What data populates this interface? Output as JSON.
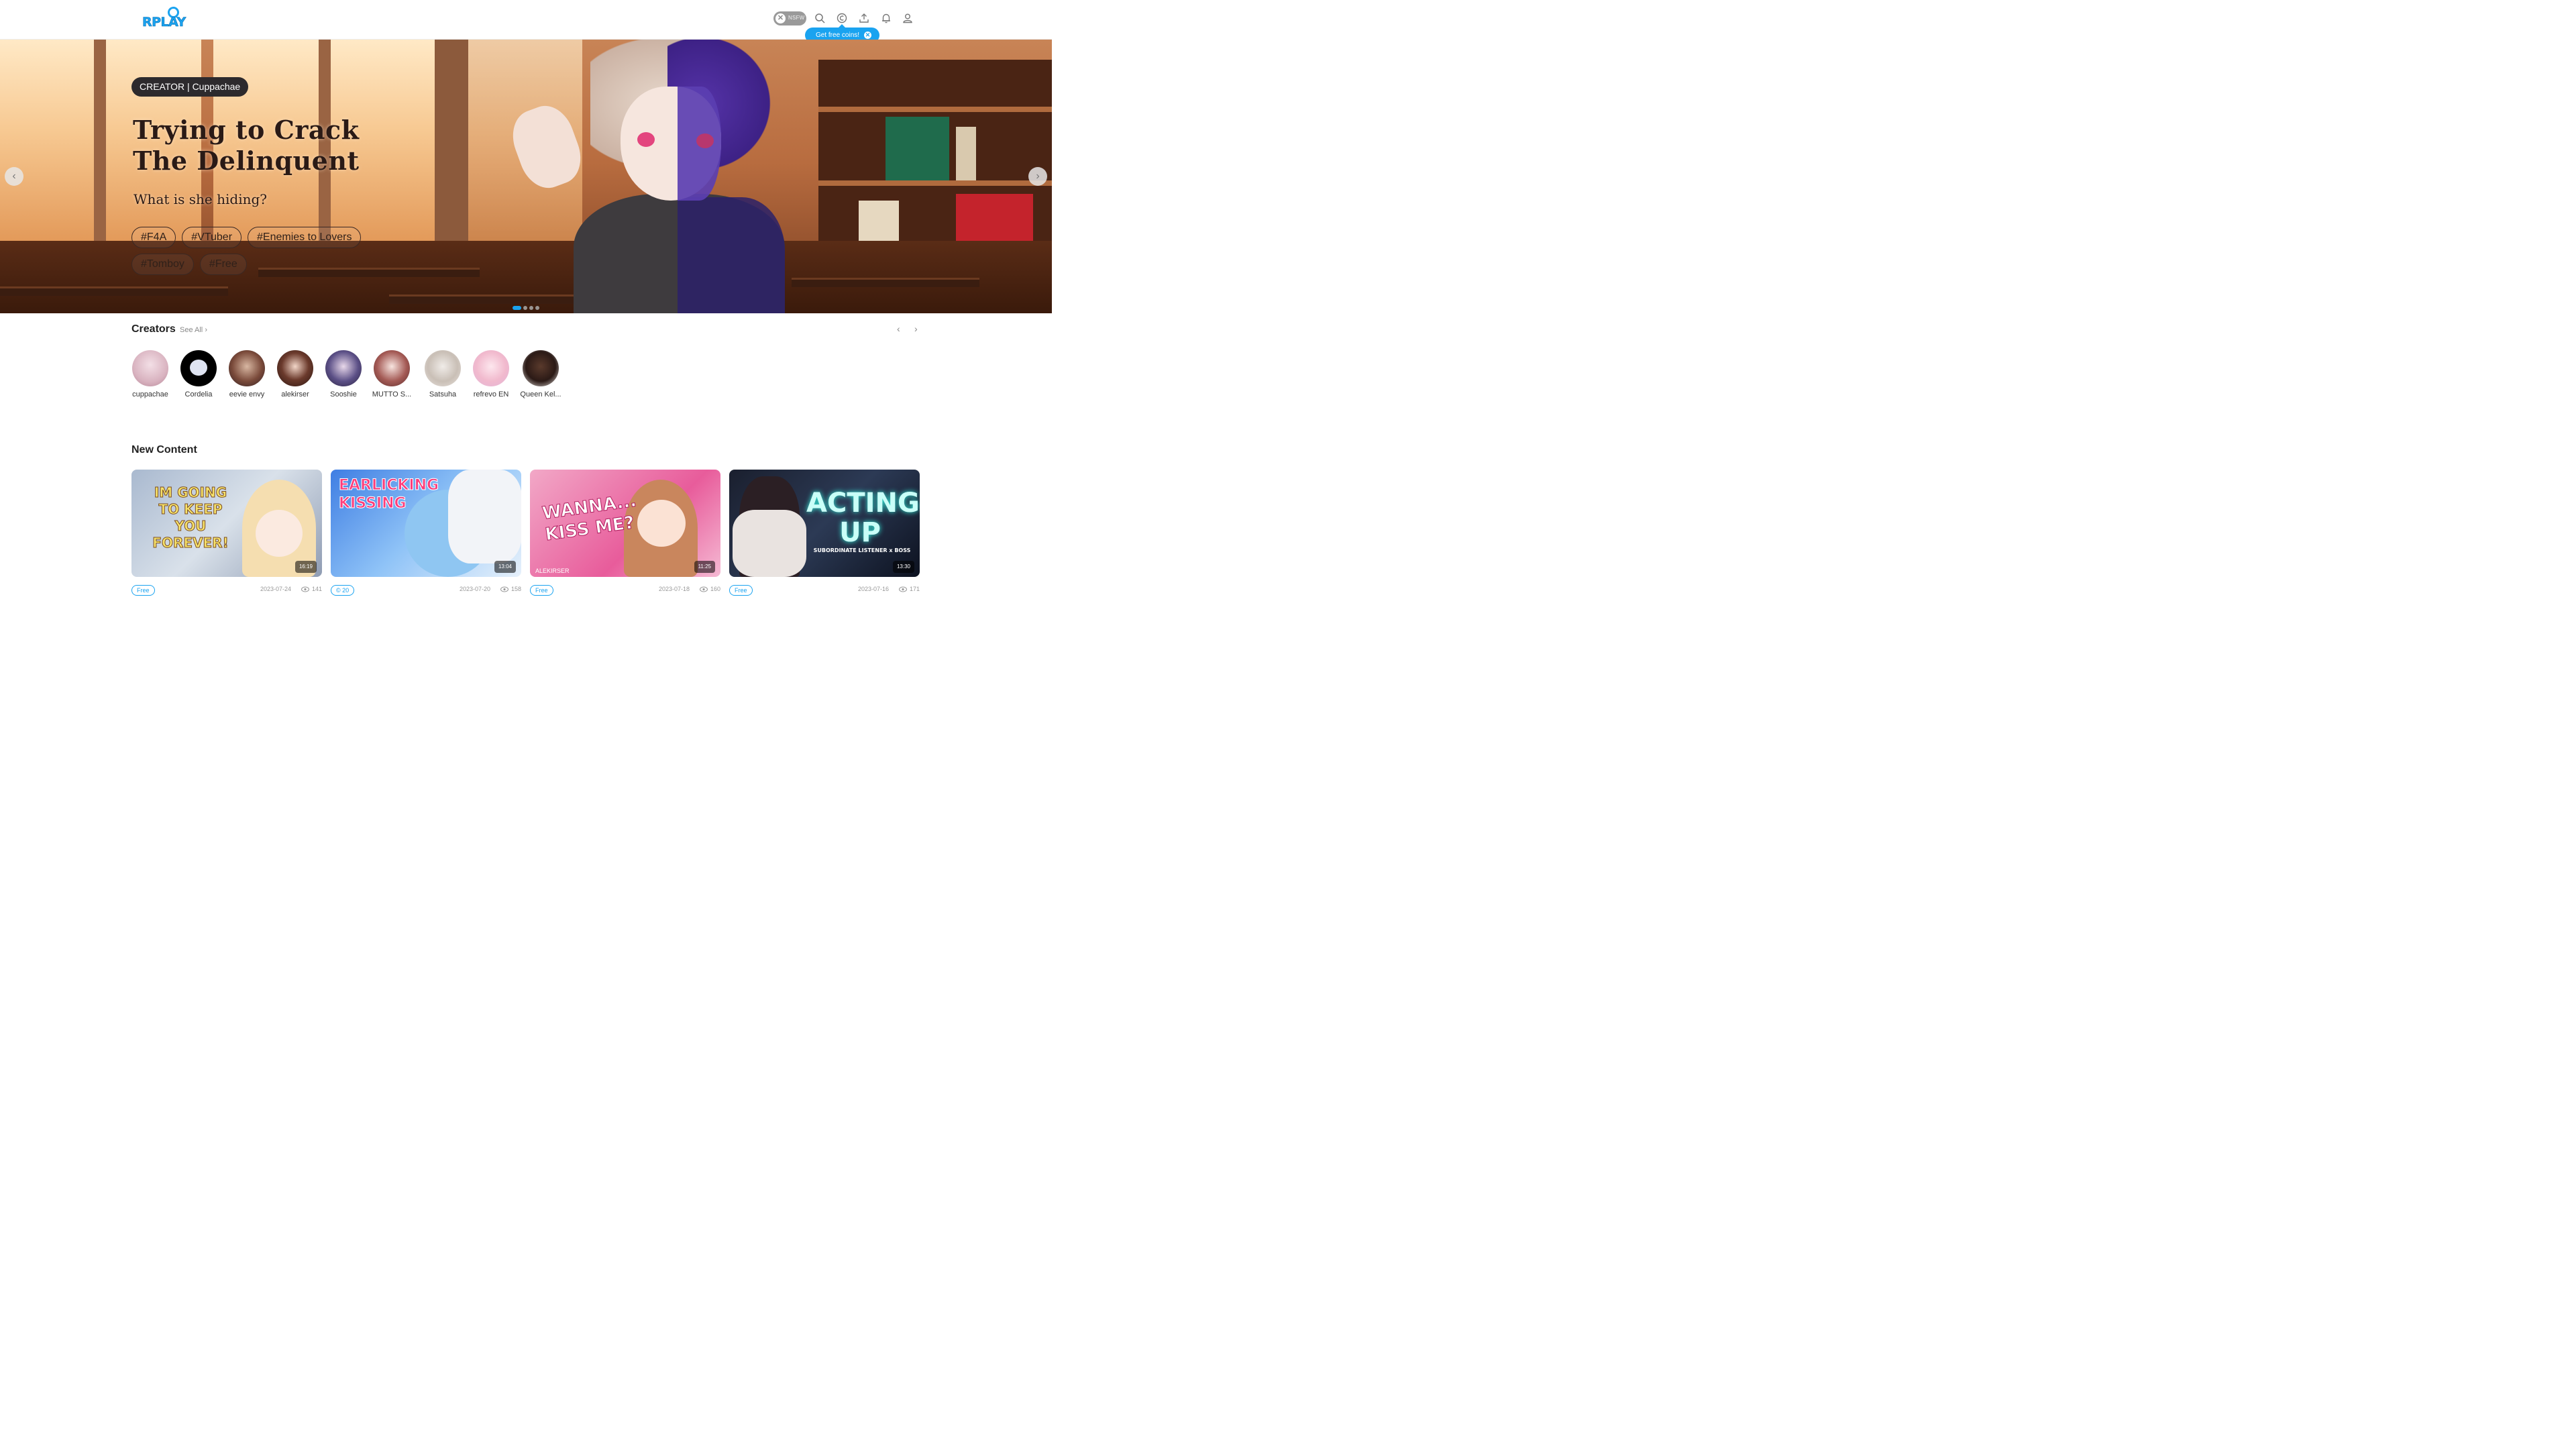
{
  "header": {
    "logo": "RPLAY",
    "nsfw_label": "NSFW",
    "tooltip_label": "Get free coins!",
    "icons": [
      "search-icon",
      "coin-icon",
      "upload-icon",
      "bell-icon",
      "user-icon"
    ]
  },
  "hero": {
    "creator_pill": "CREATOR | Cuppachae",
    "title": "Trying to Crack\nThe Delinquent",
    "subtitle": "What is she hiding?",
    "tags": [
      "#F4A",
      "#VTuber",
      "#Enemies to Lovers",
      "#Tomboy",
      "#Free"
    ],
    "slides_total": 4,
    "active_slide": 1
  },
  "creators": {
    "title": "Creators",
    "see_all": "See All",
    "items": [
      {
        "name": "cuppachae"
      },
      {
        "name": "Cordelia"
      },
      {
        "name": "eevie envy"
      },
      {
        "name": "alekirser"
      },
      {
        "name": "Sooshie"
      },
      {
        "name": "MUTTO S..."
      },
      {
        "name": "Satsuha"
      },
      {
        "name": "refrevo EN"
      },
      {
        "name": "Queen Kel..."
      }
    ]
  },
  "new_content": {
    "title": "New Content",
    "cards": [
      {
        "thumb_text": "IM GOING TO KEEP YOU FOREVER!",
        "duration": "16:19",
        "price": "Free",
        "date": "2023-07-24",
        "views": "141"
      },
      {
        "thumb_text": "EARLICKING KISSING",
        "duration": "13:04",
        "price": "20",
        "date": "2023-07-20",
        "views": "158"
      },
      {
        "thumb_text": "WANNA... KISS ME?",
        "watermark": "ALEKIRSER",
        "duration": "11:25",
        "price": "Free",
        "date": "2023-07-18",
        "views": "160"
      },
      {
        "thumb_text": "ACTING UP",
        "thumb_sub": "SUBORDINATE LISTENER x BOSS",
        "duration": "13:30",
        "price": "Free",
        "date": "2023-07-16",
        "views": "171"
      }
    ]
  },
  "colors": {
    "accent": "#1aa3f0",
    "hero_pill": "#2d2a2d"
  }
}
